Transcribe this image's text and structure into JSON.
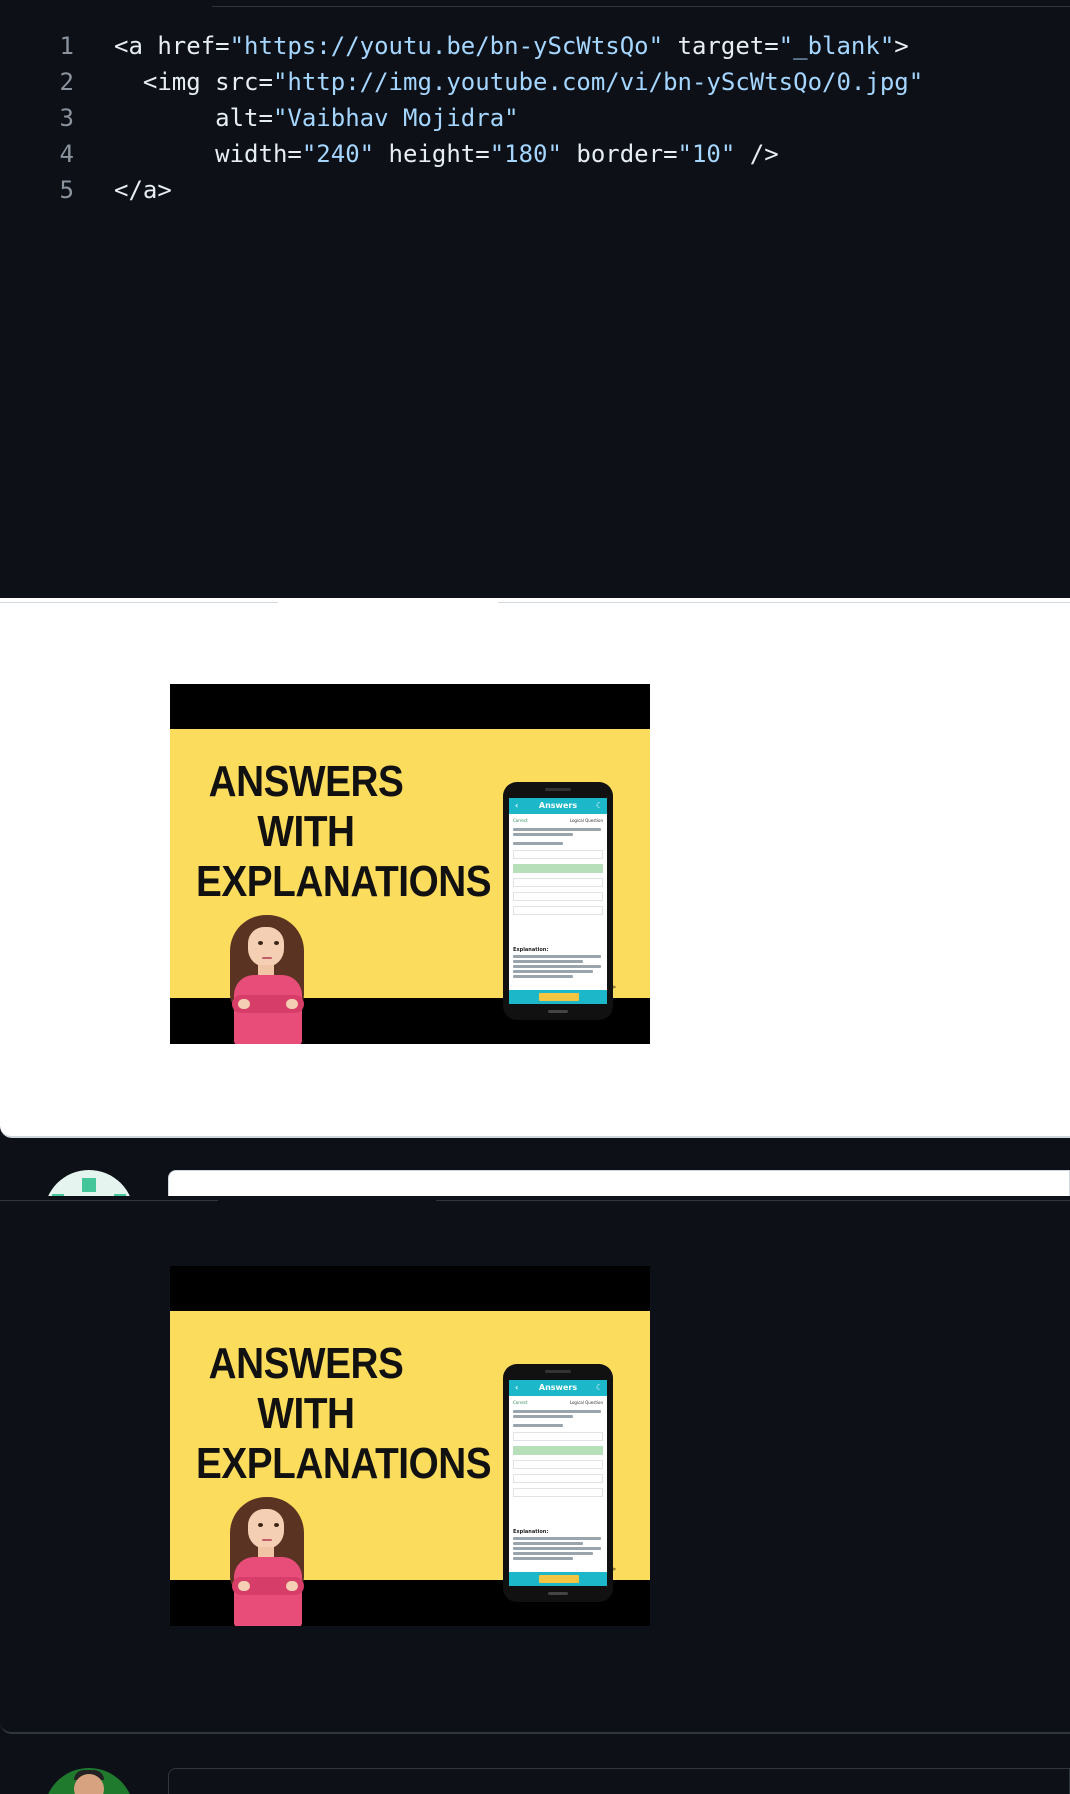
{
  "code_block": {
    "lines": [
      {
        "number": "1",
        "segments": [
          {
            "t": "tag",
            "v": "<a href="
          },
          {
            "t": "str",
            "v": "\"https://youtu.be/bn-yScWtsQo\""
          },
          {
            "t": "tag",
            "v": " target="
          },
          {
            "t": "str",
            "v": "\"_blank\""
          },
          {
            "t": "tag",
            "v": ">"
          }
        ]
      },
      {
        "number": "2",
        "segments": [
          {
            "t": "tag",
            "v": "  <img src="
          },
          {
            "t": "str",
            "v": "\"http://img.youtube.com/vi/bn-yScWtsQo/0.jpg\""
          }
        ]
      },
      {
        "number": "3",
        "segments": [
          {
            "t": "tag",
            "v": "       alt="
          },
          {
            "t": "str",
            "v": "\"Vaibhav Mojidra\""
          }
        ]
      },
      {
        "number": "4",
        "segments": [
          {
            "t": "tag",
            "v": "       width="
          },
          {
            "t": "str",
            "v": "\"240\""
          },
          {
            "t": "tag",
            "v": " height="
          },
          {
            "t": "str",
            "v": "\"180\""
          },
          {
            "t": "tag",
            "v": " border="
          },
          {
            "t": "str",
            "v": "\"10\""
          },
          {
            "t": "tag",
            "v": " />"
          }
        ]
      },
      {
        "number": "5",
        "segments": [
          {
            "t": "tag",
            "v": "</a>"
          }
        ]
      }
    ]
  },
  "thumbnail": {
    "headline_line1": "ANSWERS WITH",
    "headline_line2": "EXPLANATIONS",
    "phone_title": "Answers",
    "phone_status": "Correct",
    "phone_category": "Logical Question",
    "phone_explanation_label": "Explanation:"
  },
  "colors": {
    "code_background": "#0d1117",
    "string_color": "#a5d6ff",
    "thumbnail_yellow": "#fcdc5c",
    "app_teal": "#1cb8c9"
  }
}
